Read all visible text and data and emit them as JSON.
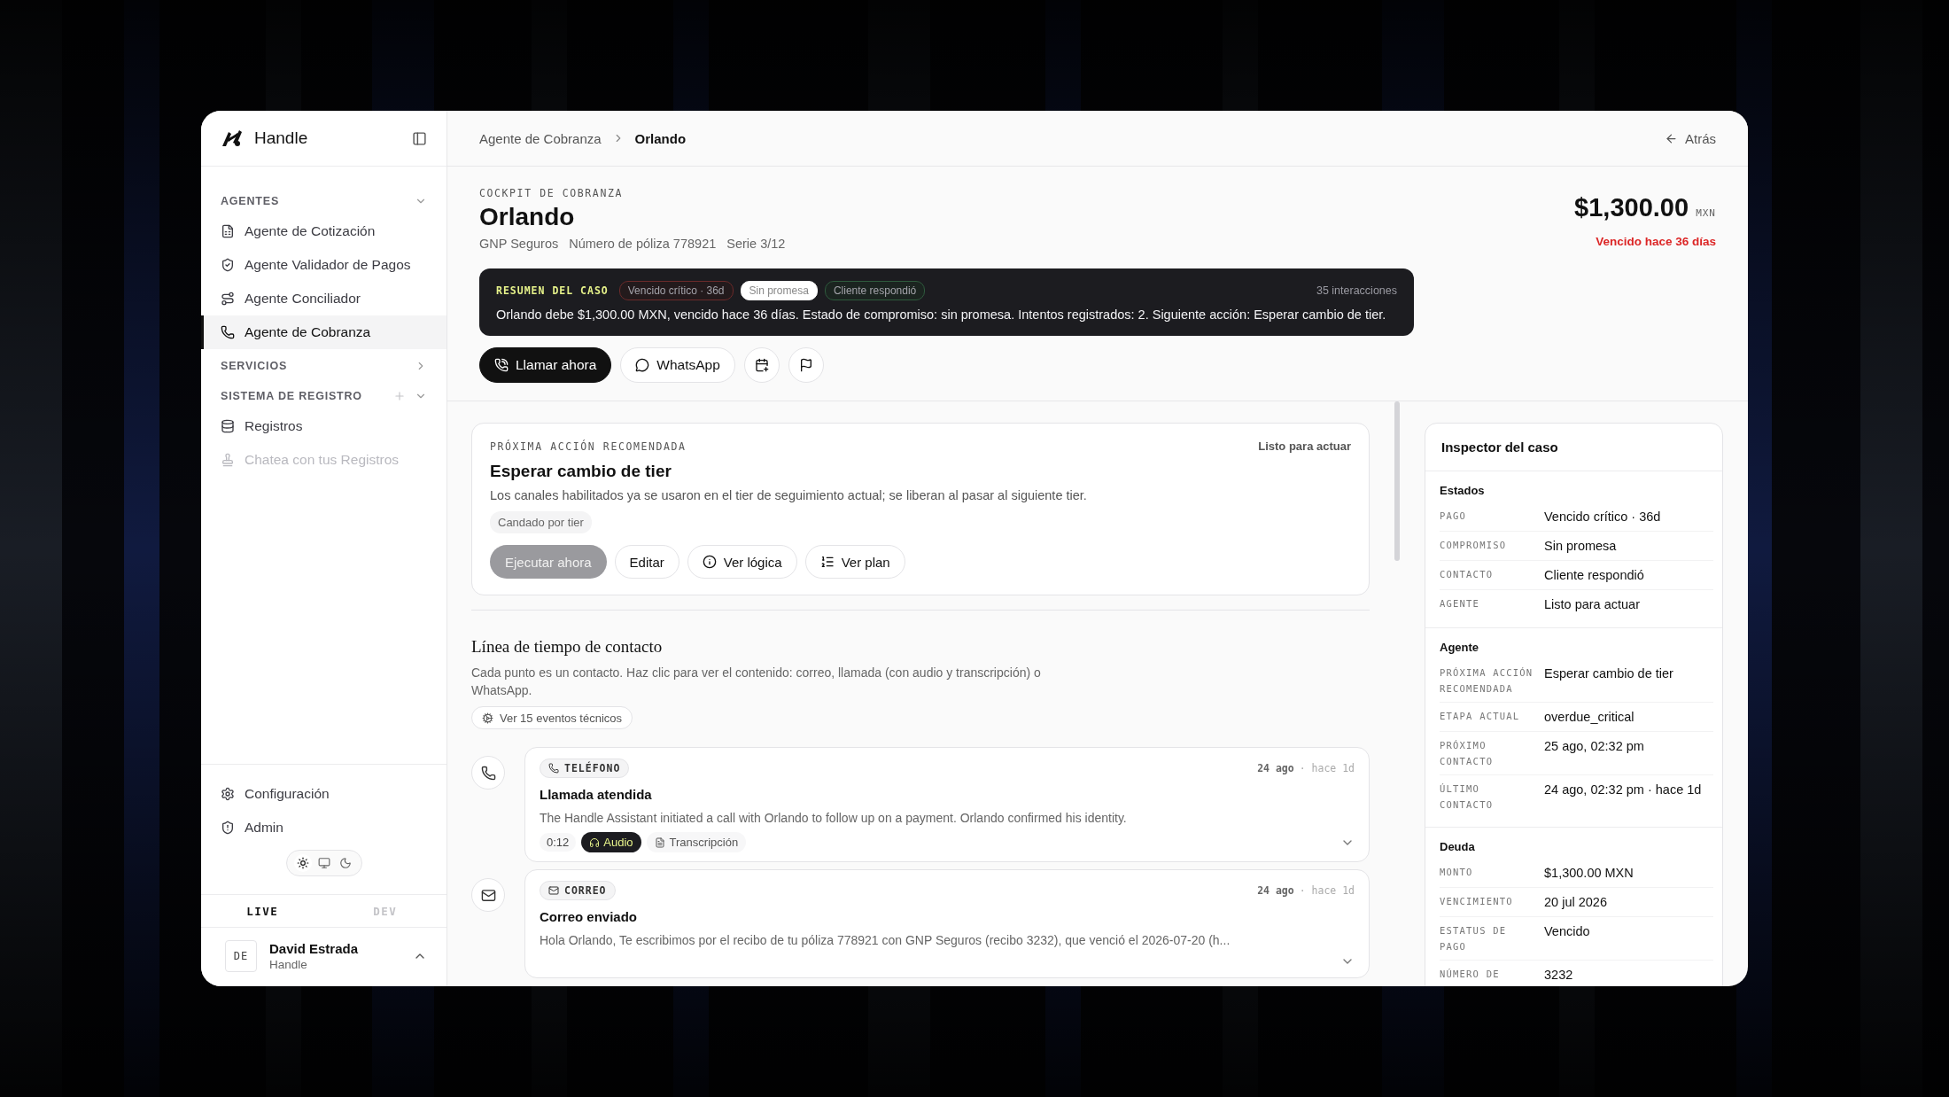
{
  "sidebar": {
    "brand": "Handle",
    "sections": [
      {
        "title": "AGENTES",
        "expanded": true,
        "add_button": false,
        "items": [
          {
            "label": "Agente de Cotización",
            "selected": false,
            "disabled": false
          },
          {
            "label": "Agente Validador de Pagos",
            "selected": false,
            "disabled": false
          },
          {
            "label": "Agente Conciliador",
            "selected": false,
            "disabled": false
          },
          {
            "label": "Agente de Cobranza",
            "selected": true,
            "disabled": false
          }
        ]
      },
      {
        "title": "SERVICIOS",
        "expanded": false,
        "add_button": false
      },
      {
        "title": "SISTEMA DE REGISTRO",
        "expanded": true,
        "add_button": true,
        "items": [
          {
            "label": "Registros",
            "selected": false,
            "disabled": false
          },
          {
            "label": "Chatea con tus Registros",
            "selected": false,
            "disabled": true
          }
        ]
      }
    ],
    "footer_items": [
      "Configuración",
      "Admin"
    ],
    "theme_options": [
      {
        "kind": "light",
        "selected": true
      },
      {
        "kind": "system",
        "selected": false
      },
      {
        "kind": "dark",
        "selected": false
      }
    ],
    "environments": [
      {
        "label": "LIVE",
        "selected": true
      },
      {
        "label": "DEV",
        "selected": false
      }
    ],
    "user": {
      "initials": "DE",
      "name": "David Estrada",
      "org": "Handle"
    }
  },
  "topbar": {
    "breadcrumb": [
      "Agente de Cobranza",
      "Orlando"
    ],
    "back": "Atrás"
  },
  "case": {
    "eyebrow": "COCKPIT DE COBRANZA",
    "name": "Orlando",
    "meta": [
      "GNP Seguros",
      "Número de póliza 778921",
      "Serie 3/12"
    ],
    "amount": "$1,300.00",
    "currency": "MXN",
    "overdue": "Vencido hace 36 días"
  },
  "summary": {
    "label": "RESUMEN DEL CASO",
    "chips": [
      {
        "text": "Vencido crítico · 36d",
        "kind": "danger"
      },
      {
        "text": "Sin promesa",
        "kind": "neutral"
      },
      {
        "text": "Cliente respondió",
        "kind": "success"
      }
    ],
    "count": "35 interacciones",
    "text": "Orlando debe $1,300.00 MXN, vencido hace 36 días. Estado de compromiso: sin promesa. Intentos registrados: 2. Siguiente acción: Esperar cambio de tier."
  },
  "actions": [
    {
      "kind": "call",
      "label": "Llamar ahora"
    },
    {
      "kind": "whatsapp",
      "label": "WhatsApp"
    },
    {
      "kind": "schedule"
    },
    {
      "kind": "flag"
    }
  ],
  "next_action": {
    "eyebrow": "PRÓXIMA ACCIÓN RECOMENDADA",
    "status": "Listo para actuar",
    "title": "Esperar cambio de tier",
    "description": "Los canales habilitados ya se usaron en el tier de seguimiento actual; se liberan al pasar al siguiente tier.",
    "tag": "Candado por tier",
    "buttons": [
      {
        "kind": "run",
        "label": "Ejecutar ahora",
        "disabled": true
      },
      {
        "kind": "edit",
        "label": "Editar",
        "disabled": false
      },
      {
        "kind": "logic",
        "label": "Ver lógica",
        "disabled": false
      },
      {
        "kind": "plan",
        "label": "Ver plan",
        "disabled": false
      }
    ]
  },
  "timeline": {
    "title": "Línea de tiempo de contacto",
    "description": "Cada punto es un contacto. Haz clic para ver el contenido: correo, llamada (con audio y transcripción) o WhatsApp.",
    "tech_events": "Ver 15 eventos técnicos",
    "events": [
      {
        "kind": "phone",
        "channel": "TELÉFONO",
        "date": "24 ago",
        "ago": "· hace 1d",
        "title": "Llamada atendida",
        "text": "The Handle Assistant initiated a call with Orlando to follow up on a payment. Orlando confirmed his identity.",
        "duration": "0:12",
        "audio": "Audio",
        "transcript": "Transcripción"
      },
      {
        "kind": "email",
        "channel": "CORREO",
        "date": "24 ago",
        "ago": "· hace 1d",
        "title": "Correo enviado",
        "text": "Hola Orlando, Te escribimos por el recibo de tu póliza 778921 con GNP Seguros (recibo 3232), que venció el 2026-07-20 (h..."
      }
    ]
  },
  "inspector": {
    "title": "Inspector del caso",
    "sections": [
      {
        "title": "Estados",
        "rows": [
          {
            "label": "PAGO",
            "value": "Vencido crítico · 36d"
          },
          {
            "label": "COMPROMISO",
            "value": "Sin promesa"
          },
          {
            "label": "CONTACTO",
            "value": "Cliente respondió"
          },
          {
            "label": "AGENTE",
            "value": "Listo para actuar"
          }
        ]
      },
      {
        "title": "Agente",
        "rows": [
          {
            "label": "PRÓXIMA ACCIÓN RECOMENDADA",
            "value": "Esperar cambio de tier"
          },
          {
            "label": "ETAPA ACTUAL",
            "value": "overdue_critical"
          },
          {
            "label": "PRÓXIMO CONTACTO",
            "value": "25 ago, 02:32 pm"
          },
          {
            "label": "ÚLTIMO CONTACTO",
            "value": "24 ago, 02:32 pm · hace 1d"
          }
        ]
      },
      {
        "title": "Deuda",
        "rows": [
          {
            "label": "MONTO",
            "value": "$1,300.00 MXN"
          },
          {
            "label": "VENCIMIENTO",
            "value": "20 jul 2026"
          },
          {
            "label": "ESTATUS DE PAGO",
            "value": "Vencido"
          },
          {
            "label": "NÚMERO DE",
            "value": "3232"
          }
        ]
      }
    ]
  }
}
